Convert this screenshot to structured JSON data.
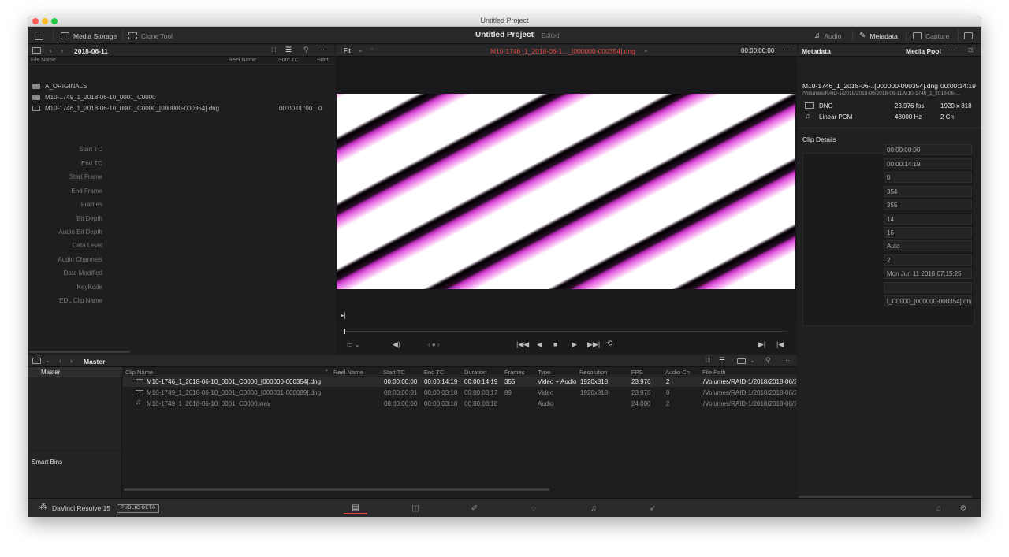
{
  "window": {
    "title": "Untitled Project"
  },
  "toolbar": {
    "media_storage": "Media Storage",
    "clone_tool": "Clone Tool",
    "project_title": "Untitled Project",
    "project_status": "Edited",
    "audio": "Audio",
    "metadata": "Metadata",
    "capture": "Capture"
  },
  "media_storage": {
    "path": "2018-06-11",
    "columns": [
      "File Name",
      "Reel Name",
      "Start TC",
      "Start"
    ],
    "items": [
      {
        "type": "folder",
        "name": "A_ORIGINALS",
        "start_tc": "",
        "start": ""
      },
      {
        "type": "folder",
        "name": "M10-1749_1_2018-06-10_0001_C0000",
        "start_tc": "",
        "start": ""
      },
      {
        "type": "file",
        "name": "M10-1746_1_2018-06-10_0001_C0000_[000000-000354].dng",
        "start_tc": "00:00:00:00",
        "start": "0"
      }
    ]
  },
  "viewer": {
    "zoom": "Fit",
    "clip_name": "M10-1746_1_2018-06-1..._[000000-000354].dng",
    "timecode": "00:00:00:00"
  },
  "metadata": {
    "header": "Metadata",
    "pool_label": "Media Pool",
    "clip_title": "M10-1746_1_2018-06-..[000000-000354].dng",
    "clip_duration": "00:00:14:19",
    "clip_path": "/Volumes/RAID-1/2018/2018-06/2018-06-11/M10-1746_1_2018-06-...",
    "video_codec": "DNG",
    "video_fps": "23.976 fps",
    "video_res": "1920 x 818",
    "audio_codec": "Linear PCM",
    "audio_rate": "48000 Hz",
    "audio_ch": "2 Ch",
    "details_title": "Clip Details",
    "fields": [
      {
        "label": "Start TC",
        "value": "00:00:00:00"
      },
      {
        "label": "End TC",
        "value": "00:00:14:19"
      },
      {
        "label": "Start Frame",
        "value": "0"
      },
      {
        "label": "End Frame",
        "value": "354"
      },
      {
        "label": "Frames",
        "value": "355"
      },
      {
        "label": "Bit Depth",
        "value": "14"
      },
      {
        "label": "Audio Bit Depth",
        "value": "16"
      },
      {
        "label": "Data Level",
        "value": "Auto"
      },
      {
        "label": "Audio Channels",
        "value": "2"
      },
      {
        "label": "Date Modified",
        "value": "Mon Jun 11 2018 07:15:25"
      },
      {
        "label": "KeyKode",
        "value": ""
      },
      {
        "label": "EDL Clip Name",
        "value": "l_C0000_[000000-000354].dng"
      }
    ]
  },
  "media_pool": {
    "bin_title": "Master",
    "bins": [
      "Master"
    ],
    "smart_bins": "Smart Bins",
    "columns": [
      "Clip Name",
      "Reel Name",
      "Start TC",
      "End TC",
      "Duration",
      "Frames",
      "Type",
      "Resolution",
      "FPS",
      "Audio Ch",
      "File Path"
    ],
    "rows": [
      {
        "name": "M10-1746_1_2018-06-10_0001_C0000_[000000-000354].dng",
        "start": "00:00:00:00",
        "end": "00:00:14:19",
        "dur": "00:00:14:19",
        "frames": "355",
        "type": "Video + Audio",
        "res": "1920x818",
        "fps": "23.976",
        "ach": "2",
        "path": "/Volumes/RAID-1/2018/2018-06/2"
      },
      {
        "name": "M10-1749_1_2018-06-10_0001_C0000_[000001-000089].dng",
        "start": "00:00:00:01",
        "end": "00:00:03:18",
        "dur": "00:00:03:17",
        "frames": "89",
        "type": "Video",
        "res": "1920x818",
        "fps": "23.976",
        "ach": "0",
        "path": "/Volumes/RAID-1/2018/2018-06/2"
      },
      {
        "name": "M10-1749_1_2018-06-10_0001_C0000.wav",
        "start": "00:00:00:00",
        "end": "00:00:03:18",
        "dur": "00:00:03:18",
        "frames": "",
        "type": "Audio",
        "res": "",
        "fps": "24.000",
        "ach": "2",
        "path": "/Volumes/RAID-1/2018/2018-06/2"
      }
    ]
  },
  "footer": {
    "app_name": "DaVinci Resolve 15",
    "badge": "PUBLIC BETA"
  }
}
